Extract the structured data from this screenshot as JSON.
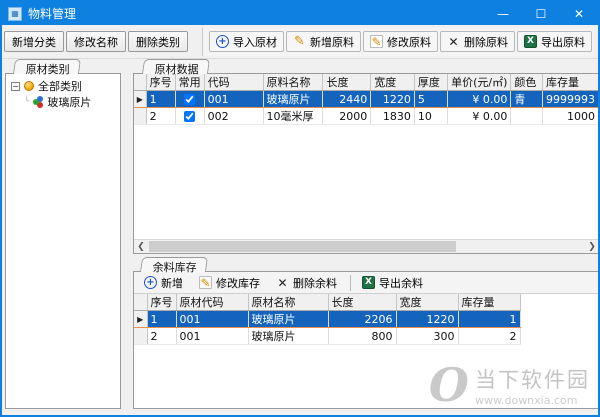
{
  "window": {
    "title": "物料管理",
    "controls": {
      "minimize": "—",
      "maximize": "☐",
      "close": "✕"
    }
  },
  "toolbar": {
    "category_buttons": [
      {
        "label": "新增分类"
      },
      {
        "label": "修改名称"
      },
      {
        "label": "删除类别"
      }
    ],
    "material_buttons": [
      {
        "label": "导入原材",
        "icon": "plus-circle-icon"
      },
      {
        "label": "新增原料",
        "icon": "pencil-icon"
      },
      {
        "label": "修改原料",
        "icon": "edit-icon"
      },
      {
        "label": "删除原料",
        "icon": "delete-x-icon"
      },
      {
        "label": "导出原料",
        "icon": "excel-icon"
      }
    ]
  },
  "left_panel": {
    "tab": "原材类别",
    "tree": {
      "root": "全部类别",
      "children": [
        "玻璃原片"
      ]
    }
  },
  "materials": {
    "tab": "原材数据",
    "selected_row": 0,
    "columns": [
      {
        "label": "序号"
      },
      {
        "label": "常用",
        "type": "checkbox"
      },
      {
        "label": "代码"
      },
      {
        "label": "原料名称"
      },
      {
        "label": "长度"
      },
      {
        "label": "宽度"
      },
      {
        "label": "厚度"
      },
      {
        "label": "单价(元/㎡)"
      },
      {
        "label": "颜色"
      },
      {
        "label": "库存量"
      }
    ],
    "rows": [
      {
        "cells": [
          "1",
          true,
          "001",
          "玻璃原片",
          "2440",
          "1220",
          "5",
          "¥ 0.00",
          "青",
          "9999993"
        ]
      },
      {
        "cells": [
          "2",
          true,
          "002",
          "10毫米厚",
          "2000",
          "1830",
          "10",
          "¥ 0.00",
          "",
          "1000"
        ]
      }
    ]
  },
  "remnants": {
    "tab": "余料库存",
    "buttons": [
      {
        "label": "新增",
        "icon": "plus-circle-icon"
      },
      {
        "label": "修改库存",
        "icon": "edit-icon"
      },
      {
        "label": "删除余料",
        "icon": "delete-x-icon"
      },
      {
        "label": "导出余料",
        "icon": "excel-icon"
      }
    ],
    "selected_row": 0,
    "columns": [
      {
        "label": "序号"
      },
      {
        "label": "原材代码"
      },
      {
        "label": "原材名称"
      },
      {
        "label": "长度"
      },
      {
        "label": "宽度"
      },
      {
        "label": "库存量"
      }
    ],
    "rows": [
      {
        "cells": [
          "1",
          "001",
          "玻璃原片",
          "2206",
          "1220",
          "1"
        ]
      },
      {
        "cells": [
          "2",
          "001",
          "玻璃原片",
          "800",
          "300",
          "2"
        ]
      }
    ]
  },
  "watermark": {
    "logo": "O",
    "site": "当下软件园",
    "url": "www.downxia.com"
  },
  "colors": {
    "titlebar": "#0d80e0",
    "selection_bg": "#1464be",
    "selection_border": "#e89050",
    "excel_green": "#1f7244",
    "pencil_orange": "#d88c00",
    "plus_blue": "#1a53c8"
  }
}
